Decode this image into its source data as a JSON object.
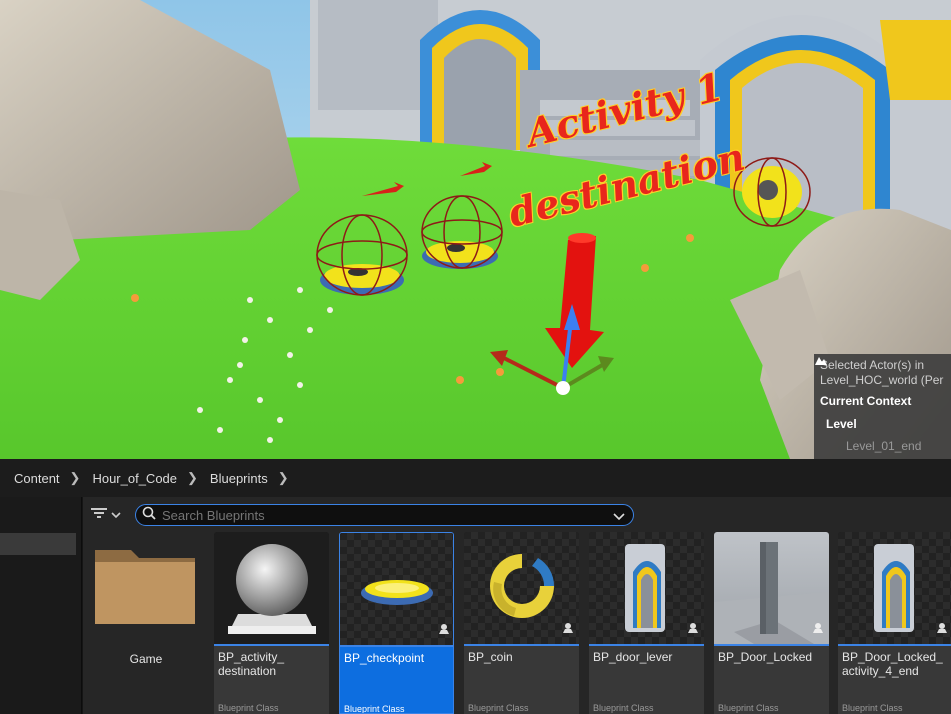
{
  "viewport": {
    "label_line1": "Activity 1",
    "label_line2": "destination",
    "selected_panel": {
      "selected_line1": "Selected Actor(s) in",
      "selected_line2": "Level_HOC_world (Per",
      "context_title": "Current Context",
      "level_label": "Level",
      "level_name": "Level_01_end"
    }
  },
  "breadcrumb": [
    "Content",
    "Hour_of_Code",
    "Blueprints"
  ],
  "search": {
    "placeholder": "Search Blueprints",
    "value": ""
  },
  "folders": [
    {
      "name": "Game"
    }
  ],
  "assets": [
    {
      "name": "BP_activity_ destination",
      "type": "Blueprint Class",
      "thumb": "sphere",
      "selected": false
    },
    {
      "name": "BP_checkpoint",
      "type": "Blueprint Class",
      "thumb": "checkpoint",
      "selected": true
    },
    {
      "name": "BP_coin",
      "type": "Blueprint Class",
      "thumb": "coin",
      "selected": false
    },
    {
      "name": "BP_door_lever",
      "type": "Blueprint Class",
      "thumb": "door",
      "selected": false
    },
    {
      "name": "BP_Door_Locked",
      "type": "Blueprint Class",
      "thumb": "pillar",
      "selected": false
    },
    {
      "name": "BP_Door_Locked_ activity_4_end",
      "type": "Blueprint Class",
      "thumb": "door",
      "selected": false
    }
  ],
  "colors": {
    "accent": "#0d6ee0",
    "search_border": "#3b83e6",
    "label_red": "#e8261c",
    "label_outline": "#ffcf2a"
  }
}
